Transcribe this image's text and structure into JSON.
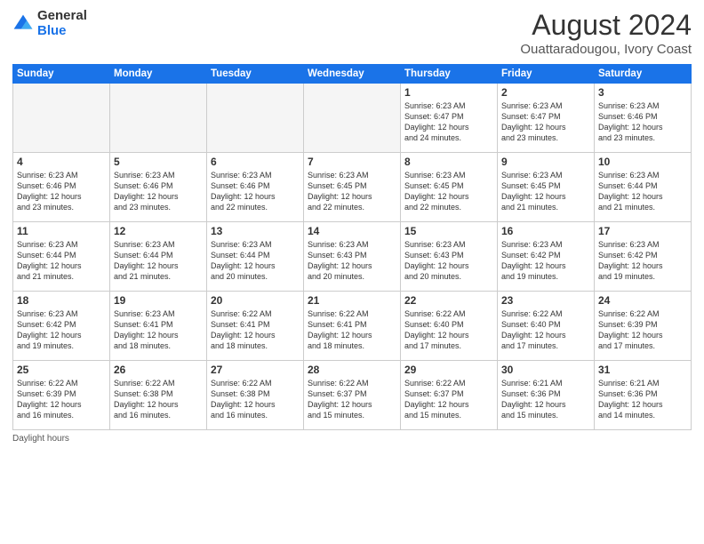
{
  "logo": {
    "general": "General",
    "blue": "Blue"
  },
  "title": "August 2024",
  "subtitle": "Ouattaradougou, Ivory Coast",
  "days_of_week": [
    "Sunday",
    "Monday",
    "Tuesday",
    "Wednesday",
    "Thursday",
    "Friday",
    "Saturday"
  ],
  "weeks": [
    [
      {
        "num": "",
        "empty": true
      },
      {
        "num": "",
        "empty": true
      },
      {
        "num": "",
        "empty": true
      },
      {
        "num": "",
        "empty": true
      },
      {
        "num": "1",
        "sunrise": "6:23 AM",
        "sunset": "6:47 PM",
        "daylight": "12 hours and 24 minutes."
      },
      {
        "num": "2",
        "sunrise": "6:23 AM",
        "sunset": "6:47 PM",
        "daylight": "12 hours and 23 minutes."
      },
      {
        "num": "3",
        "sunrise": "6:23 AM",
        "sunset": "6:46 PM",
        "daylight": "12 hours and 23 minutes."
      }
    ],
    [
      {
        "num": "4",
        "sunrise": "6:23 AM",
        "sunset": "6:46 PM",
        "daylight": "12 hours and 23 minutes."
      },
      {
        "num": "5",
        "sunrise": "6:23 AM",
        "sunset": "6:46 PM",
        "daylight": "12 hours and 23 minutes."
      },
      {
        "num": "6",
        "sunrise": "6:23 AM",
        "sunset": "6:46 PM",
        "daylight": "12 hours and 22 minutes."
      },
      {
        "num": "7",
        "sunrise": "6:23 AM",
        "sunset": "6:45 PM",
        "daylight": "12 hours and 22 minutes."
      },
      {
        "num": "8",
        "sunrise": "6:23 AM",
        "sunset": "6:45 PM",
        "daylight": "12 hours and 22 minutes."
      },
      {
        "num": "9",
        "sunrise": "6:23 AM",
        "sunset": "6:45 PM",
        "daylight": "12 hours and 21 minutes."
      },
      {
        "num": "10",
        "sunrise": "6:23 AM",
        "sunset": "6:44 PM",
        "daylight": "12 hours and 21 minutes."
      }
    ],
    [
      {
        "num": "11",
        "sunrise": "6:23 AM",
        "sunset": "6:44 PM",
        "daylight": "12 hours and 21 minutes."
      },
      {
        "num": "12",
        "sunrise": "6:23 AM",
        "sunset": "6:44 PM",
        "daylight": "12 hours and 21 minutes."
      },
      {
        "num": "13",
        "sunrise": "6:23 AM",
        "sunset": "6:44 PM",
        "daylight": "12 hours and 20 minutes."
      },
      {
        "num": "14",
        "sunrise": "6:23 AM",
        "sunset": "6:43 PM",
        "daylight": "12 hours and 20 minutes."
      },
      {
        "num": "15",
        "sunrise": "6:23 AM",
        "sunset": "6:43 PM",
        "daylight": "12 hours and 20 minutes."
      },
      {
        "num": "16",
        "sunrise": "6:23 AM",
        "sunset": "6:42 PM",
        "daylight": "12 hours and 19 minutes."
      },
      {
        "num": "17",
        "sunrise": "6:23 AM",
        "sunset": "6:42 PM",
        "daylight": "12 hours and 19 minutes."
      }
    ],
    [
      {
        "num": "18",
        "sunrise": "6:23 AM",
        "sunset": "6:42 PM",
        "daylight": "12 hours and 19 minutes."
      },
      {
        "num": "19",
        "sunrise": "6:23 AM",
        "sunset": "6:41 PM",
        "daylight": "12 hours and 18 minutes."
      },
      {
        "num": "20",
        "sunrise": "6:22 AM",
        "sunset": "6:41 PM",
        "daylight": "12 hours and 18 minutes."
      },
      {
        "num": "21",
        "sunrise": "6:22 AM",
        "sunset": "6:41 PM",
        "daylight": "12 hours and 18 minutes."
      },
      {
        "num": "22",
        "sunrise": "6:22 AM",
        "sunset": "6:40 PM",
        "daylight": "12 hours and 17 minutes."
      },
      {
        "num": "23",
        "sunrise": "6:22 AM",
        "sunset": "6:40 PM",
        "daylight": "12 hours and 17 minutes."
      },
      {
        "num": "24",
        "sunrise": "6:22 AM",
        "sunset": "6:39 PM",
        "daylight": "12 hours and 17 minutes."
      }
    ],
    [
      {
        "num": "25",
        "sunrise": "6:22 AM",
        "sunset": "6:39 PM",
        "daylight": "12 hours and 16 minutes."
      },
      {
        "num": "26",
        "sunrise": "6:22 AM",
        "sunset": "6:38 PM",
        "daylight": "12 hours and 16 minutes."
      },
      {
        "num": "27",
        "sunrise": "6:22 AM",
        "sunset": "6:38 PM",
        "daylight": "12 hours and 16 minutes."
      },
      {
        "num": "28",
        "sunrise": "6:22 AM",
        "sunset": "6:37 PM",
        "daylight": "12 hours and 15 minutes."
      },
      {
        "num": "29",
        "sunrise": "6:22 AM",
        "sunset": "6:37 PM",
        "daylight": "12 hours and 15 minutes."
      },
      {
        "num": "30",
        "sunrise": "6:21 AM",
        "sunset": "6:36 PM",
        "daylight": "12 hours and 15 minutes."
      },
      {
        "num": "31",
        "sunrise": "6:21 AM",
        "sunset": "6:36 PM",
        "daylight": "12 hours and 14 minutes."
      }
    ]
  ],
  "daylight_label": "Daylight hours"
}
